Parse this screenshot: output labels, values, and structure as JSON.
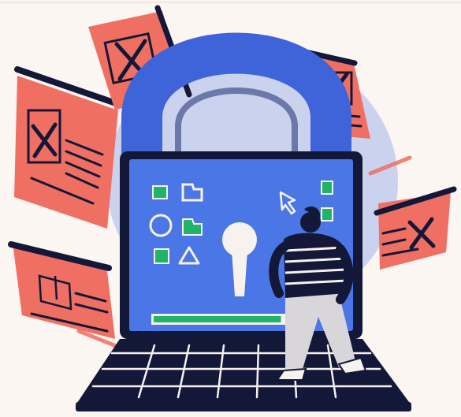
{
  "illustration": {
    "subject": "security-lock-laptop",
    "colors": {
      "background": "#fbf6f1",
      "lock_blue": "#3f63d9",
      "lock_shadow": "#1f2c73",
      "screen_blue": "#4a76e6",
      "navy": "#141838",
      "coral": "#ef6f63",
      "green": "#22b36b",
      "white": "#f6f2ee",
      "gray": "#d8d6d8"
    },
    "icons": [
      "close-x-icon",
      "document-icon",
      "cursor-arrow-icon",
      "keyhole-icon",
      "circle-icon",
      "triangle-icon",
      "folder-icon"
    ],
    "progress_fraction": 0.85
  }
}
